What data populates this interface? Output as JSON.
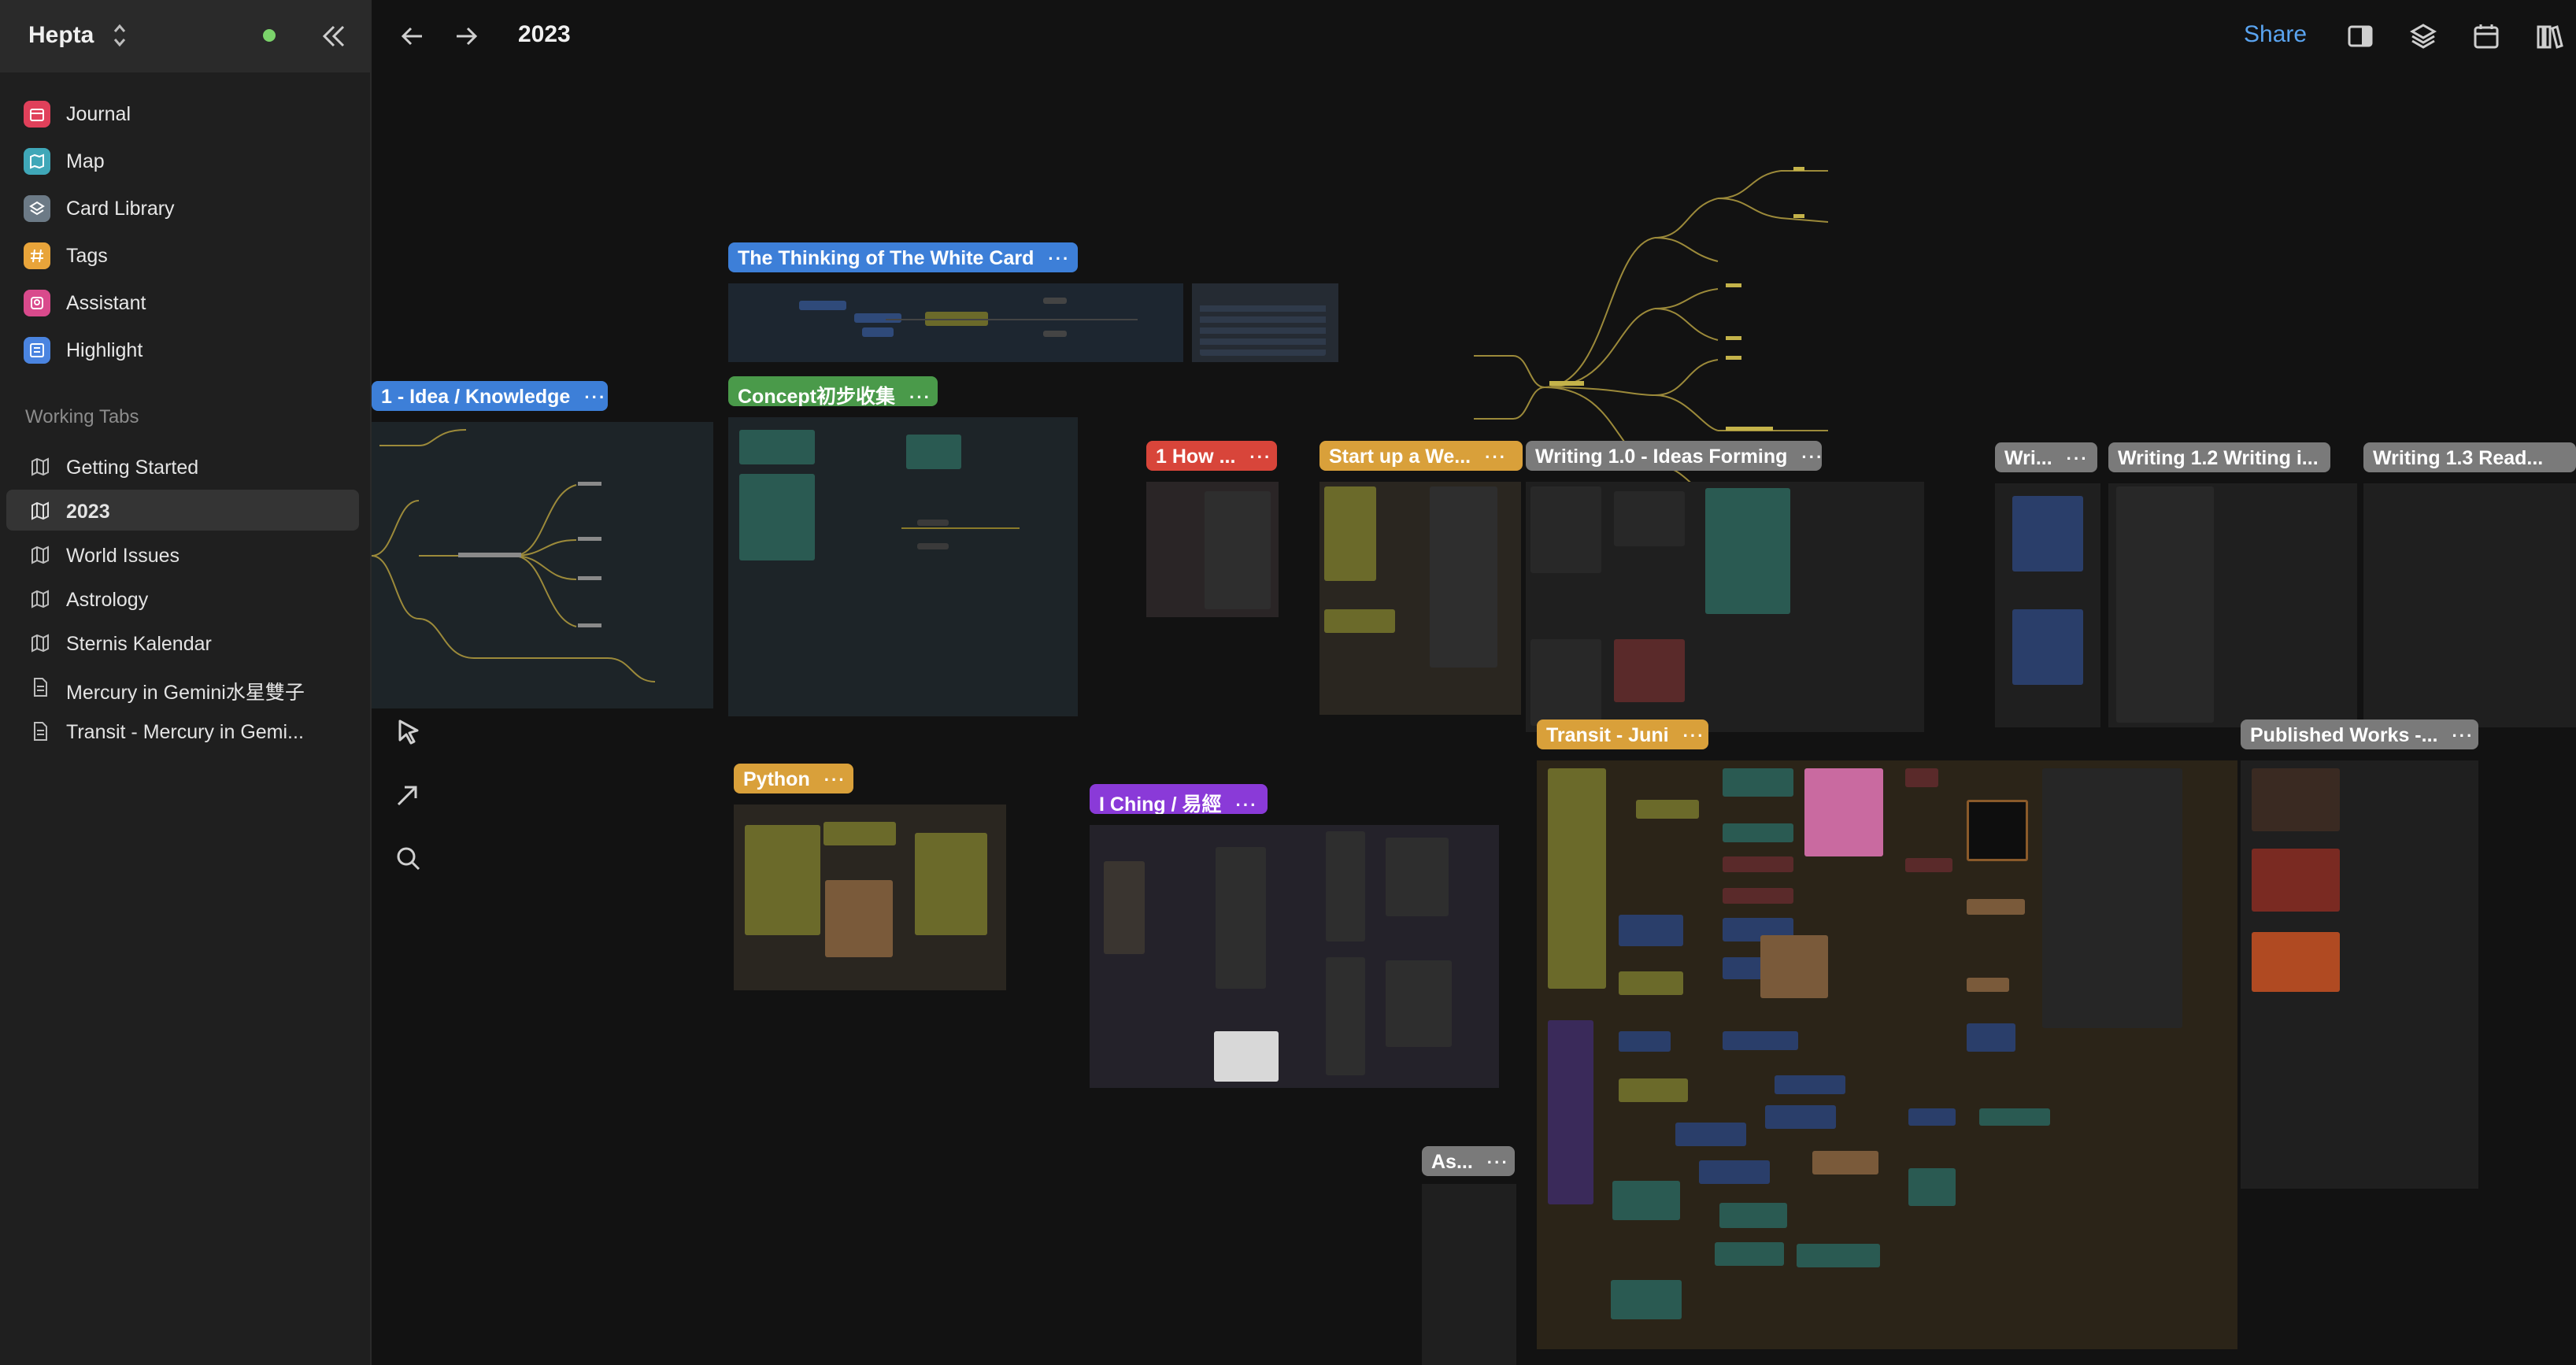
{
  "app": {
    "name": "Hepta"
  },
  "sidebar": {
    "nav": [
      {
        "label": "Journal",
        "icon": "calendar-icon",
        "color": "#e0405a"
      },
      {
        "label": "Map",
        "icon": "map-icon",
        "color": "#3fa7b8"
      },
      {
        "label": "Card Library",
        "icon": "layers-icon",
        "color": "#6c7a86"
      },
      {
        "label": "Tags",
        "icon": "hash-icon",
        "color": "#e8a43a"
      },
      {
        "label": "Assistant",
        "icon": "assistant-icon",
        "color": "#d94a8c"
      },
      {
        "label": "Highlight",
        "icon": "highlight-icon",
        "color": "#4a84e0"
      }
    ],
    "tabs_heading": "Working Tabs",
    "tabs": [
      {
        "label": "Getting Started",
        "icon": "map-icon"
      },
      {
        "label": "2023",
        "icon": "map-icon",
        "active": true
      },
      {
        "label": "World Issues",
        "icon": "map-icon"
      },
      {
        "label": "Astrology",
        "icon": "map-icon"
      },
      {
        "label": "Sternis Kalendar",
        "icon": "map-icon"
      },
      {
        "label": "Mercury in Gemini水星雙子",
        "icon": "document-icon"
      },
      {
        "label": "Transit - Mercury in Gemi...",
        "icon": "document-icon"
      }
    ]
  },
  "topbar": {
    "title": "2023",
    "share_label": "Share"
  },
  "canvas": {
    "groups": [
      {
        "label": "The Thinking of The White Card",
        "color": "#3d7fd8"
      },
      {
        "label": "1  - Idea / Knowledge",
        "color": "#3d7fd8"
      },
      {
        "label": "Concept初步收集",
        "color": "#4a9a4a"
      },
      {
        "label": "1 How ...",
        "color": "#d8453a"
      },
      {
        "label": "Start up a We...",
        "color": "#d9a03a"
      },
      {
        "label": "Writing 1.0 - Ideas Forming",
        "color": "#7a7a7a"
      },
      {
        "label": "Wri...",
        "color": "#7a7a7a"
      },
      {
        "label": "Writing 1.2 Writing i...",
        "color": "#7a7a7a"
      },
      {
        "label": "Writing 1.3 Read...",
        "color": "#7a7a7a"
      },
      {
        "label": "Transit - Juni",
        "color": "#d9a03a"
      },
      {
        "label": "Published Works -...",
        "color": "#7a7a7a"
      },
      {
        "label": "Python",
        "color": "#d9a03a"
      },
      {
        "label": "I Ching / 易經",
        "color": "#8a3ad8"
      },
      {
        "label": "As...",
        "color": "#7a7a7a"
      }
    ],
    "more_label": "···"
  },
  "colors": {
    "accent": "#5aa4f0",
    "online": "#7bd36b"
  }
}
